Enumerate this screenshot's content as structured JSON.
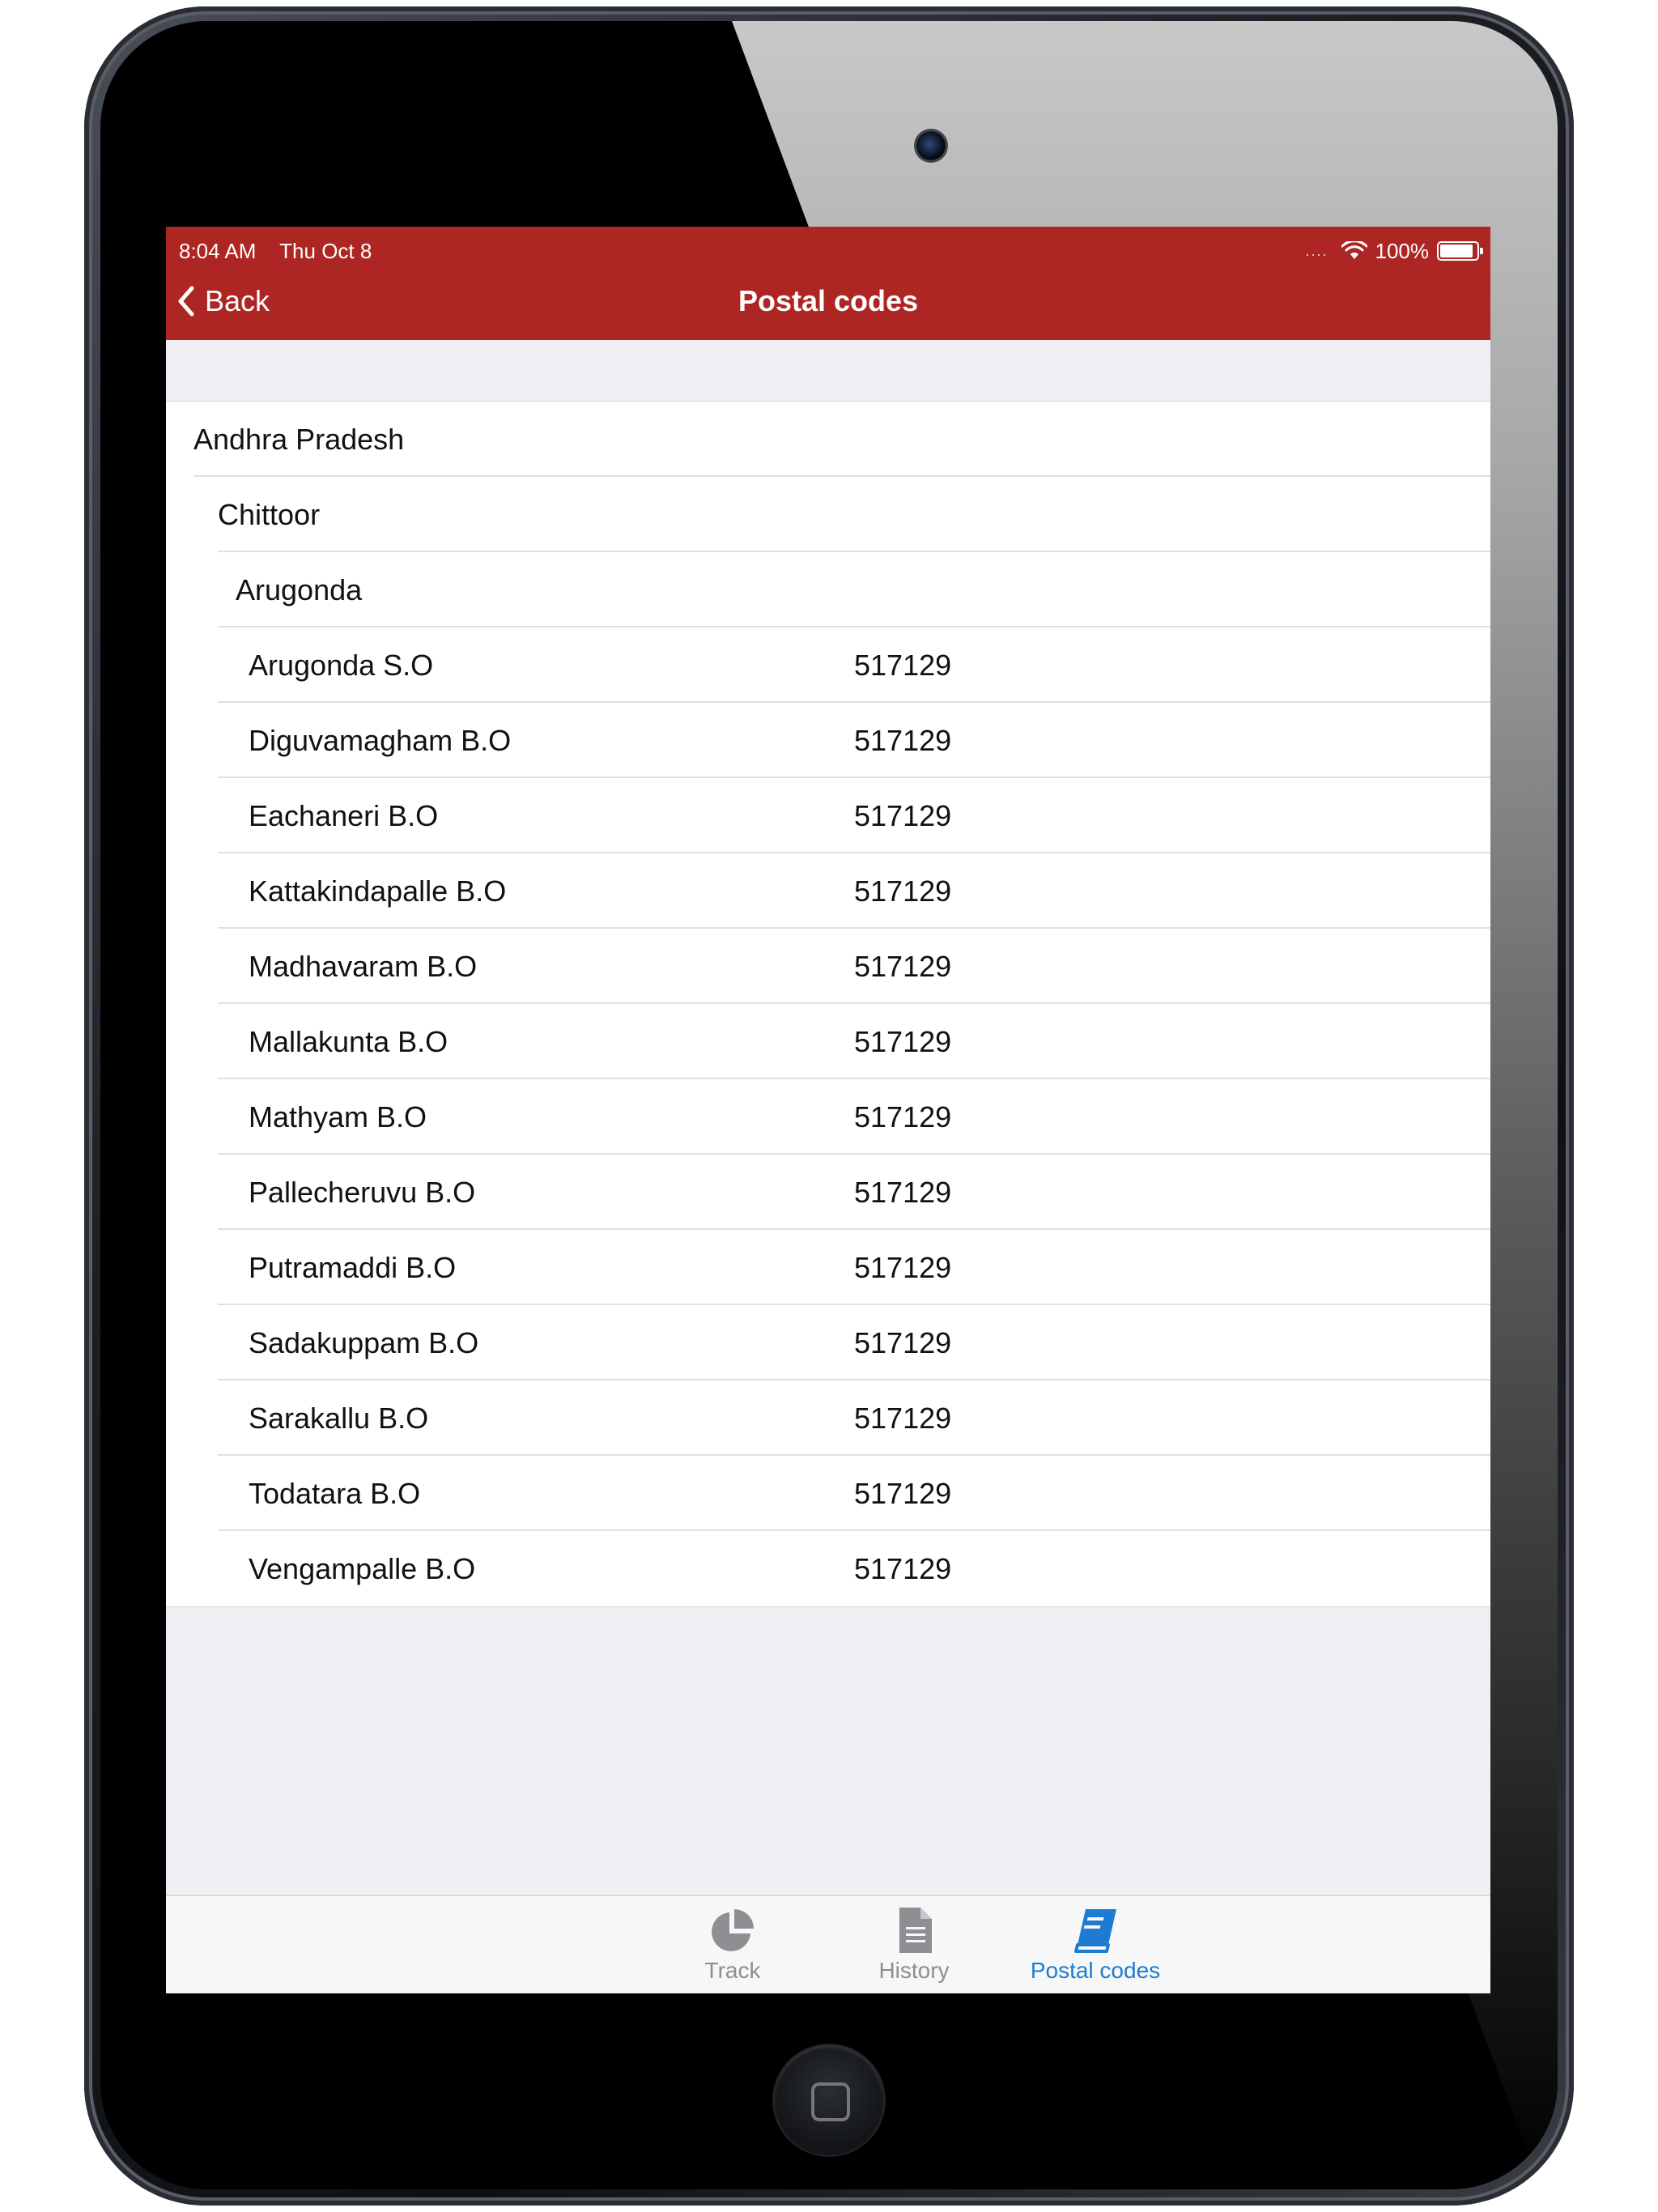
{
  "status_bar": {
    "time": "8:04 AM",
    "date": "Thu Oct 8",
    "signal": "....",
    "battery": "100%"
  },
  "nav": {
    "back_label": "Back",
    "title": "Postal codes"
  },
  "tree": {
    "state": "Andhra Pradesh",
    "district": "Chittoor",
    "taluk": "Arugonda"
  },
  "offices": [
    {
      "name": "Arugonda S.O",
      "code": "517129"
    },
    {
      "name": "Diguvamagham B.O",
      "code": "517129"
    },
    {
      "name": "Eachaneri B.O",
      "code": "517129"
    },
    {
      "name": "Kattakindapalle B.O",
      "code": "517129"
    },
    {
      "name": "Madhavaram B.O",
      "code": "517129"
    },
    {
      "name": "Mallakunta B.O",
      "code": "517129"
    },
    {
      "name": "Mathyam B.O",
      "code": "517129"
    },
    {
      "name": "Pallecheruvu B.O",
      "code": "517129"
    },
    {
      "name": "Putramaddi B.O",
      "code": "517129"
    },
    {
      "name": "Sadakuppam B.O",
      "code": "517129"
    },
    {
      "name": "Sarakallu B.O",
      "code": "517129"
    },
    {
      "name": "Todatara B.O",
      "code": "517129"
    },
    {
      "name": "Vengampalle B.O",
      "code": "517129"
    }
  ],
  "tabs": [
    {
      "label": "Track",
      "icon": "pie-chart-icon"
    },
    {
      "label": "History",
      "icon": "document-icon"
    },
    {
      "label": "Postal codes",
      "icon": "book-icon",
      "active": true
    }
  ],
  "colors": {
    "nav_bar": "#ad2623",
    "tab_active": "#1f7bd1",
    "tab_inactive": "#8e8e93"
  }
}
